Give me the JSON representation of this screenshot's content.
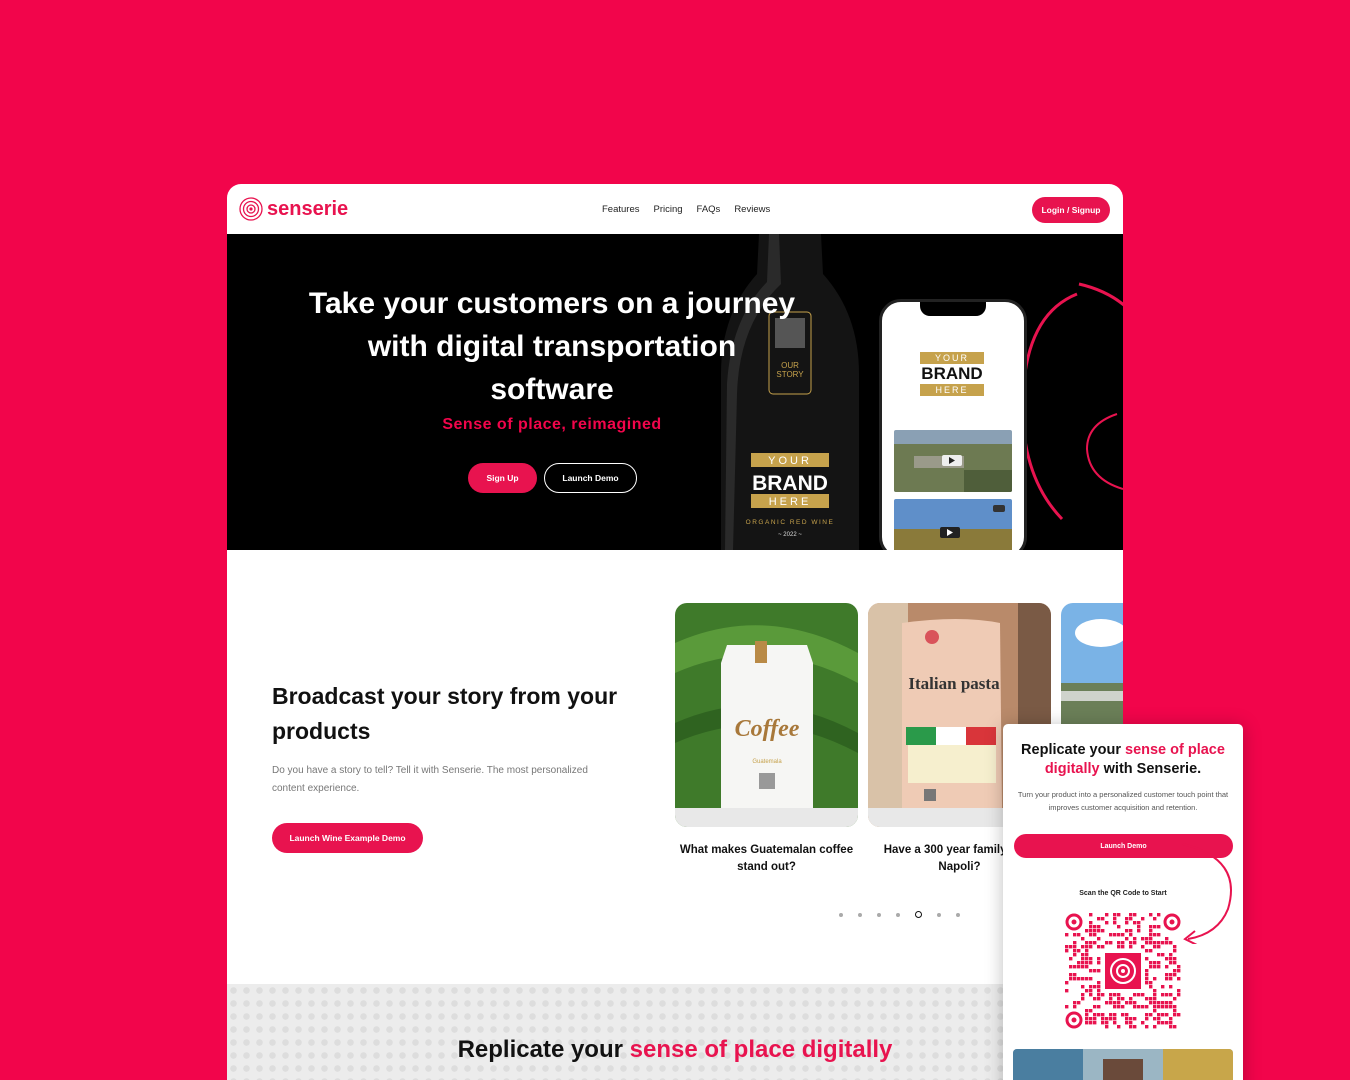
{
  "header": {
    "logo_text": "senserie",
    "nav": [
      "Features",
      "Pricing",
      "FAQs",
      "Reviews"
    ],
    "login_label": "Login / Signup"
  },
  "hero": {
    "title": "Take your customers on a journey with digital transportation software",
    "subtitle": "Sense of place, reimagined",
    "signup_label": "Sign Up",
    "demo_label": "Launch Demo",
    "bottle_label": {
      "story_line1": "OUR",
      "story_line2": "STORY",
      "brand_top": "YOUR",
      "brand_mid": "BRAND",
      "brand_bot": "HERE",
      "wine_type": "ORGANIC RED WINE",
      "year": "~ 2022 ~"
    },
    "phone_brand": {
      "top": "YOUR",
      "mid": "BRAND",
      "bot": "HERE"
    }
  },
  "broadcast": {
    "title": "Broadcast your story from your products",
    "body": "Do you have a story to tell? Tell it with Senserie. The most personalized content experience.",
    "button_label": "Launch Wine Example Demo",
    "cards": [
      {
        "caption": "What makes Guatemalan coffee stand out?",
        "product_label": "Coffee",
        "product_sub": "Guatemala"
      },
      {
        "caption": "Have a 300 year family from Napoli?",
        "product_label": "Italian pasta"
      }
    ],
    "carousel_active_index": 4,
    "carousel_count": 7
  },
  "replicate": {
    "prefix": "Replicate your ",
    "highlight": "sense of place digitally"
  },
  "popup": {
    "title_prefix": "Replicate your ",
    "title_highlight": "sense of place digitally",
    "title_suffix": " with Senserie.",
    "body": "Turn your product into a personalized customer touch point that improves customer acquisition and retention.",
    "button_label": "Launch Demo",
    "scan_label": "Scan the QR Code to Start"
  },
  "colors": {
    "brand": "#e8134f",
    "background": "#f2054b",
    "gold": "#c6a24c"
  }
}
